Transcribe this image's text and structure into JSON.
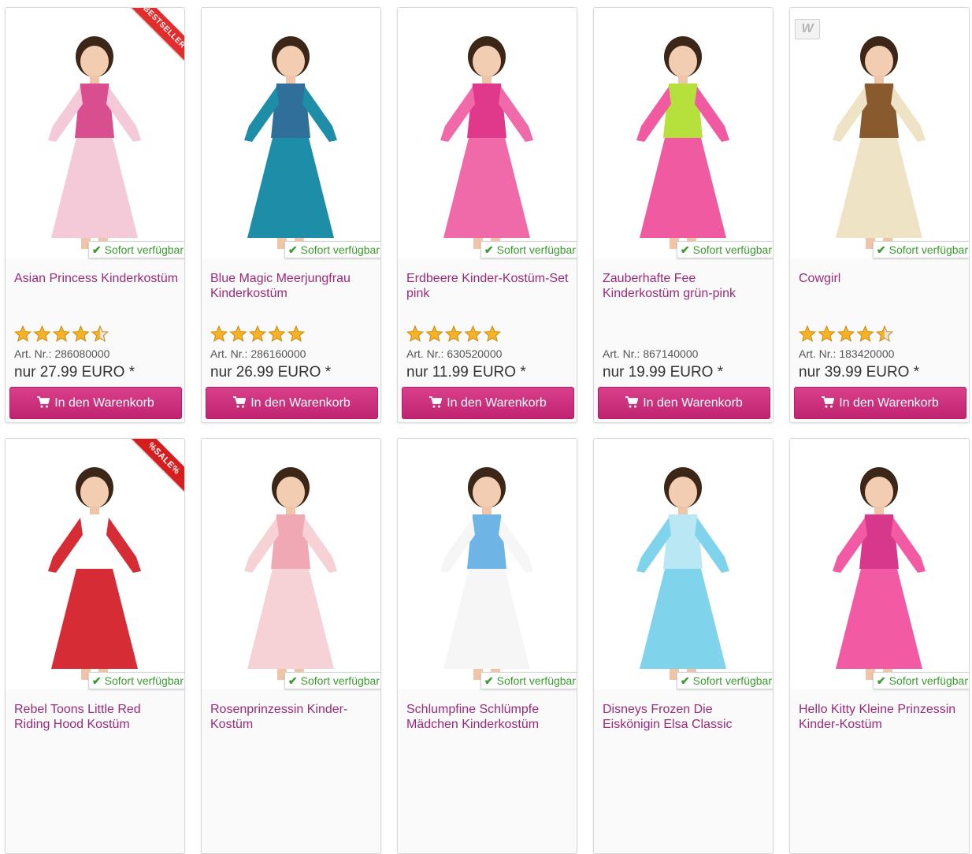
{
  "products": [
    {
      "title": "Asian Princess Kinderkostüm",
      "rating": 4.5,
      "art_nr": "Art. Nr.: 286080000",
      "price": "nur 27.99 EURO *",
      "badge": "BESTSELLER",
      "availability": "Sofort verfügbar",
      "button": "In den Warenkorb",
      "dress_color": "#f4c9d8",
      "accent_color": "#d94e8f"
    },
    {
      "title": "Blue Magic Meerjungfrau Kinderkostüm",
      "rating": 5,
      "art_nr": "Art. Nr.: 286160000",
      "price": "nur 26.99 EURO *",
      "badge": "",
      "availability": "Sofort verfügbar",
      "button": "In den Warenkorb",
      "dress_color": "#1e8da8",
      "accent_color": "#2f6f9a"
    },
    {
      "title": "Erdbeere Kinder-Kostüm-Set pink",
      "rating": 5,
      "art_nr": "Art. Nr.: 630520000",
      "price": "nur 11.99 EURO *",
      "badge": "",
      "availability": "Sofort verfügbar",
      "button": "In den Warenkorb",
      "dress_color": "#f06aa9",
      "accent_color": "#e0388a"
    },
    {
      "title": "Zauberhafte Fee Kinderkostüm grün-pink",
      "rating": 0,
      "art_nr": "Art. Nr.: 867140000",
      "price": "nur 19.99 EURO *",
      "badge": "",
      "availability": "Sofort verfügbar",
      "button": "In den Warenkorb",
      "dress_color": "#ef5aa0",
      "accent_color": "#b6e03c"
    },
    {
      "title": "Cowgirl",
      "rating": 4.5,
      "art_nr": "Art. Nr.: 183420000",
      "price": "nur 39.99 EURO *",
      "badge": "logo",
      "availability": "Sofort verfügbar",
      "button": "In den Warenkorb",
      "dress_color": "#efe3c6",
      "accent_color": "#8a5a2f"
    },
    {
      "title": "Rebel Toons Little Red Riding Hood Kostüm",
      "rating": 0,
      "art_nr": "",
      "price": "",
      "badge": "%SALE%",
      "availability": "Sofort verfügbar",
      "button": "",
      "dress_color": "#d52c35",
      "accent_color": "#ffffff"
    },
    {
      "title": "Rosenprinzessin Kinder-Kostüm",
      "rating": 0,
      "art_nr": "",
      "price": "",
      "badge": "",
      "availability": "Sofort verfügbar",
      "button": "",
      "dress_color": "#f6d2d6",
      "accent_color": "#f0a9b4"
    },
    {
      "title": "Schlumpfine Schlümpfe Mädchen Kinderkostüm",
      "rating": 0,
      "art_nr": "",
      "price": "",
      "badge": "",
      "availability": "Sofort verfügbar",
      "button": "",
      "dress_color": "#f6f6f6",
      "accent_color": "#6eb5e6"
    },
    {
      "title": "Disneys Frozen Die Eiskönigin Elsa Classic",
      "rating": 0,
      "art_nr": "",
      "price": "",
      "badge": "",
      "availability": "Sofort verfügbar",
      "button": "",
      "dress_color": "#7fd3ea",
      "accent_color": "#b9e7f3"
    },
    {
      "title": "Hello Kitty Kleine Prinzessin Kinder-Kostüm",
      "rating": 0,
      "art_nr": "",
      "price": "",
      "badge": "",
      "availability": "Sofort verfügbar",
      "button": "",
      "dress_color": "#f25aa4",
      "accent_color": "#d8388b"
    }
  ],
  "colors": {
    "title": "#9b2a7b",
    "available": "#3a9c2f",
    "button": "#c8277a",
    "star": "#f7b325"
  },
  "icons": {
    "availability": "check-icon",
    "cart": "cart-icon",
    "rating": "star-icon"
  }
}
